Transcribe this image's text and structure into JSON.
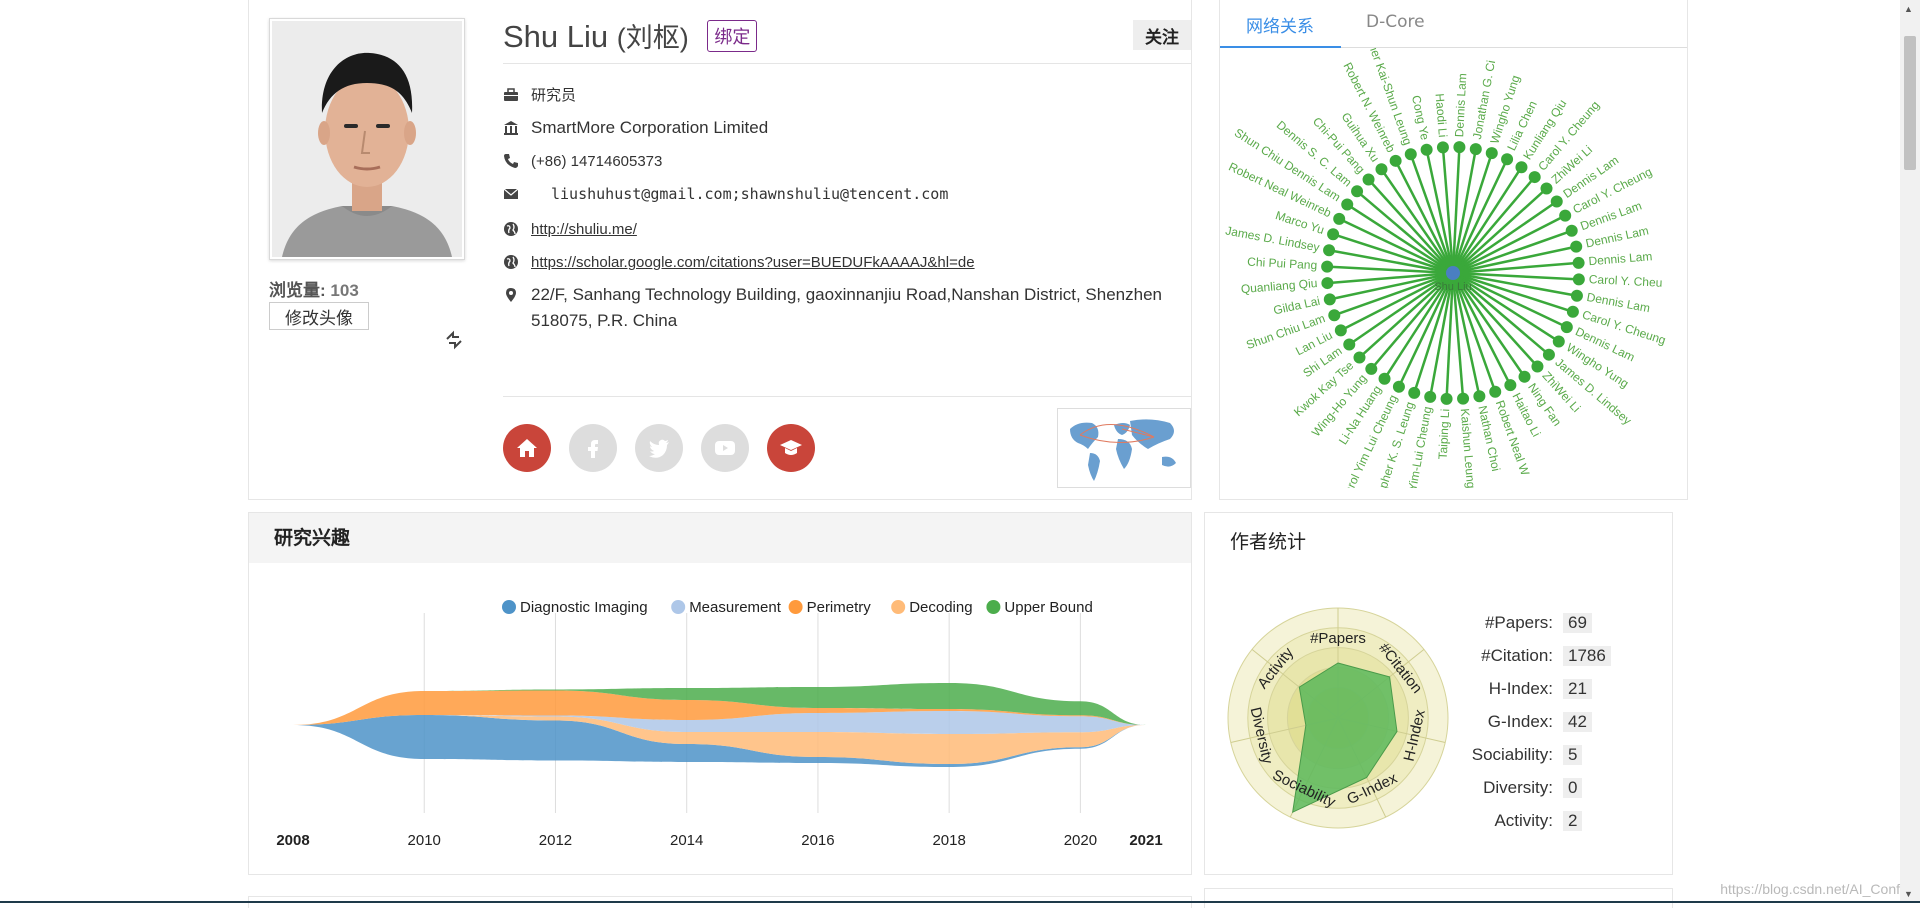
{
  "profile": {
    "name": "Shu Liu",
    "name_cn": "(刘枢)",
    "bind_label": "绑定",
    "follow_label": "关注",
    "views_label": "浏览量:",
    "views_count": "103",
    "change_avatar_label": "修改头像",
    "position": "研究员",
    "organization": "SmartMore Corporation Limited",
    "phone": "(+86) 14714605373",
    "email": "liushuhust@gmail.com;shawnshuliu@tencent.com",
    "homepage": "http://shuliu.me/",
    "scholar_url": "https://scholar.google.com/citations?user=BUEDUFkAAAAJ&hl=de",
    "address": "22/F, Sanhang Technology Building, gaoxinnanjiu Road,Nanshan District, Shenzhen 518075, P.R. China",
    "social": [
      {
        "name": "home",
        "color": "#c9453a"
      },
      {
        "name": "facebook",
        "color": "#dddddd"
      },
      {
        "name": "twitter",
        "color": "#dddddd"
      },
      {
        "name": "youtube",
        "color": "#dddddd"
      },
      {
        "name": "scholar",
        "color": "#c9453a"
      }
    ]
  },
  "network": {
    "tabs": [
      "网络关系",
      "D-Core"
    ],
    "active_tab": 0,
    "center_label": "Shu Liu",
    "edge_color": "#3aa83a",
    "center_color": "#4a7fc1",
    "nodes": [
      "Haodi Li",
      "Dennis Lam",
      "Jonathan G. Ci",
      "Wingho Yung",
      "Lilia Chen",
      "Kunliang Qiu",
      "Carol Y. Cheung",
      "ZhiWei Li",
      "Dennis Lam",
      "Carol Y. Cheung",
      "Dennis Lam",
      "Dennis Lam",
      "Dennis Lam",
      "Carol Y. Cheu",
      "Dennis Lam",
      "Carol Y. Cheung",
      "Dennis Lam",
      "Wingho Yung",
      "James D. Lindsey",
      "ZhiWei Li",
      "Ning Fan",
      "Haitao Li",
      "Robert Neal W",
      "Nathan Choi",
      "Kaishun Leung",
      "Taiping Li",
      "Yim-Lui Cheung",
      "Christopher K. S. Leung",
      "Carol Yim Lui Cheung",
      "Li-Na Huang",
      "Wing-Ho Yung",
      "Kwok Kay Tse",
      "Shi Lam",
      "Lan Liu",
      "Shun Chiu Lam",
      "Gilda Lai",
      "Quanliang Qiu",
      "Chi Pui Pang",
      "James D. Lindsey",
      "Marco Yu",
      "Robert Neal Weinreb",
      "Shun Chiu Dennis Lam",
      "Dennis S. C. Lam",
      "Chi-Pui Pang",
      "Guihua Xu",
      "Robert N. Weinreb",
      "Christopher Kai-Shun Leung",
      "Cong Ye"
    ]
  },
  "interest": {
    "title": "研究兴趣"
  },
  "chart_data": {
    "type": "area",
    "x": [
      2008,
      2010,
      2012,
      2014,
      2016,
      2018,
      2020,
      2021
    ],
    "xlim": [
      2008,
      2021
    ],
    "tick_labels": [
      "2008",
      "2010",
      "2012",
      "2014",
      "2016",
      "2018",
      "2020",
      "2021"
    ],
    "bold_ticks": [
      "2008",
      "2021"
    ],
    "legend_position": "top",
    "grid": "vertical",
    "series": [
      {
        "name": "Diagnostic Imaging",
        "color": "#4e93c8",
        "values": [
          0,
          4.4,
          4.0,
          1.8,
          0.6,
          0.3,
          0.15,
          0
        ]
      },
      {
        "name": "Measurement",
        "color": "#aec7e8",
        "values": [
          0,
          0,
          0.1,
          1.2,
          1.9,
          2.3,
          1.6,
          0
        ]
      },
      {
        "name": "Perimetry",
        "color": "#ff9a3c",
        "values": [
          0,
          2.4,
          2.5,
          2.0,
          0.5,
          0.2,
          0.1,
          0
        ]
      },
      {
        "name": "Decoding",
        "color": "#ffbb78",
        "values": [
          0,
          0,
          0.4,
          1.2,
          2.5,
          3.0,
          1.5,
          0
        ]
      },
      {
        "name": "Upper Bound",
        "color": "#4cad4c",
        "values": [
          0,
          0,
          0.1,
          1.2,
          2.1,
          2.6,
          1.4,
          0
        ]
      }
    ]
  },
  "stats": {
    "title": "作者统计",
    "items": [
      {
        "label": "#Papers:",
        "value": "69"
      },
      {
        "label": "#Citation:",
        "value": "1786"
      },
      {
        "label": "H-Index:",
        "value": "21"
      },
      {
        "label": "G-Index:",
        "value": "42"
      },
      {
        "label": "Sociability:",
        "value": "5"
      },
      {
        "label": "Diversity:",
        "value": "0"
      },
      {
        "label": "Activity:",
        "value": "2"
      }
    ],
    "radar_axes": [
      "#Papers",
      "#Citation",
      "H-Index",
      "G-Index",
      "Sociability",
      "Diversity",
      "Activity"
    ],
    "radar_levels": [
      0.5,
      0.6,
      0.55,
      0.6,
      0.95,
      0.3,
      0.45
    ],
    "radar_color": "#5cb85c"
  },
  "watermark": "https://blog.csdn.net/AI_Conf"
}
